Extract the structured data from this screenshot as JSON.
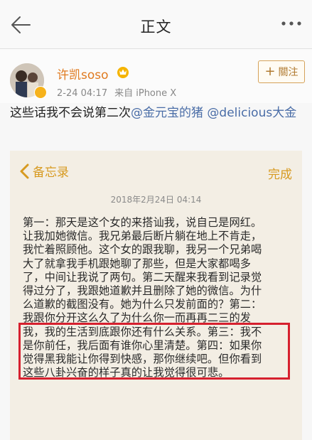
{
  "nav": {
    "title": "正文",
    "back_icon": "back-arrow-icon",
    "more_icon": "more-dots-icon"
  },
  "author": {
    "name": "许凯soso",
    "badge_icon": "vip-crown-icon",
    "time": "2-24 04:17",
    "source": "来自 iPhone X",
    "follow_label": "關注"
  },
  "post": {
    "text_prefix": "这些话我不会说第二次",
    "mention1": "@金元宝的猪",
    "mention2": "@delicious大金"
  },
  "memo": {
    "back_label": "备忘录",
    "done_label": "完成",
    "date": "2018年2月24日 04:14",
    "lines": [
      "第一：那天是这个女的来搭讪我，说自己是网红。",
      "让我加她微信。我兄弟最后断片躺在地上不肯走，",
      "我忙着照顾他。这个女的跟我聊，我另一个兄弟喝",
      "大了就拿我手机跟她聊了那些，但是大家都喝多",
      "了，中间让我说了两句。第二天醒来我看到记录觉",
      "得过分了，我跟她道歉并且删除了她的微信。为什",
      "么道歉的截图没有。她为什么只发前面的？第二：",
      "我跟你分开这么久了为什么你一而再再二三的发",
      "我，我的生活到底跟你还有什么关系。第三：我不",
      "是你前任，我后面有谁你心里清楚。第四：如果你",
      "觉得黑我能让你得到快感，那你继续吧。但你看到",
      "这些八卦兴奋的样子真的让我觉得很可悲。"
    ]
  },
  "colors": {
    "accent_orange": "#d79a20",
    "mention_blue": "#4a6da7",
    "highlight_red": "#d6202e"
  }
}
